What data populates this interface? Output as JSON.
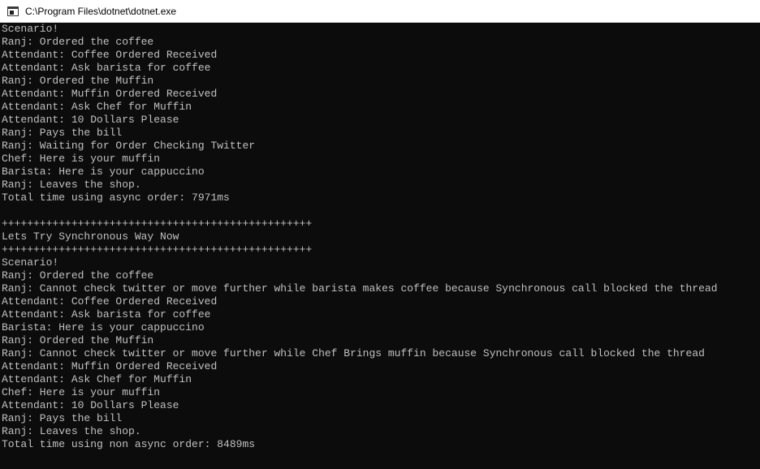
{
  "window": {
    "title": "C:\\Program Files\\dotnet\\dotnet.exe",
    "icon": "console-app-icon"
  },
  "console": {
    "lines": [
      "Scenario!",
      "Ranj: Ordered the coffee",
      "Attendant: Coffee Ordered Received",
      "Attendant: Ask barista for coffee",
      "Ranj: Ordered the Muffin",
      "Attendant: Muffin Ordered Received",
      "Attendant: Ask Chef for Muffin",
      "Attendant: 10 Dollars Please",
      "Ranj: Pays the bill",
      "Ranj: Waiting for Order Checking Twitter",
      "Chef: Here is your muffin",
      "Barista: Here is your cappuccino",
      "Ranj: Leaves the shop.",
      "Total time using async order: 7971ms",
      "",
      "+++++++++++++++++++++++++++++++++++++++++++++++++",
      "Lets Try Synchronous Way Now",
      "+++++++++++++++++++++++++++++++++++++++++++++++++",
      "Scenario!",
      "Ranj: Ordered the coffee",
      "Ranj: Cannot check twitter or move further while barista makes coffee because Synchronous call blocked the thread",
      "Attendant: Coffee Ordered Received",
      "Attendant: Ask barista for coffee",
      "Barista: Here is your cappuccino",
      "Ranj: Ordered the Muffin",
      "Ranj: Cannot check twitter or move further while Chef Brings muffin because Synchronous call blocked the thread",
      "Attendant: Muffin Ordered Received",
      "Attendant: Ask Chef for Muffin",
      "Chef: Here is your muffin",
      "Attendant: 10 Dollars Please",
      "Ranj: Pays the bill",
      "Ranj: Leaves the shop.",
      "Total time using non async order: 8489ms"
    ]
  },
  "colors": {
    "console_background": "#0c0c0c",
    "console_text": "#c0c0c0",
    "titlebar_background": "#ffffff"
  }
}
